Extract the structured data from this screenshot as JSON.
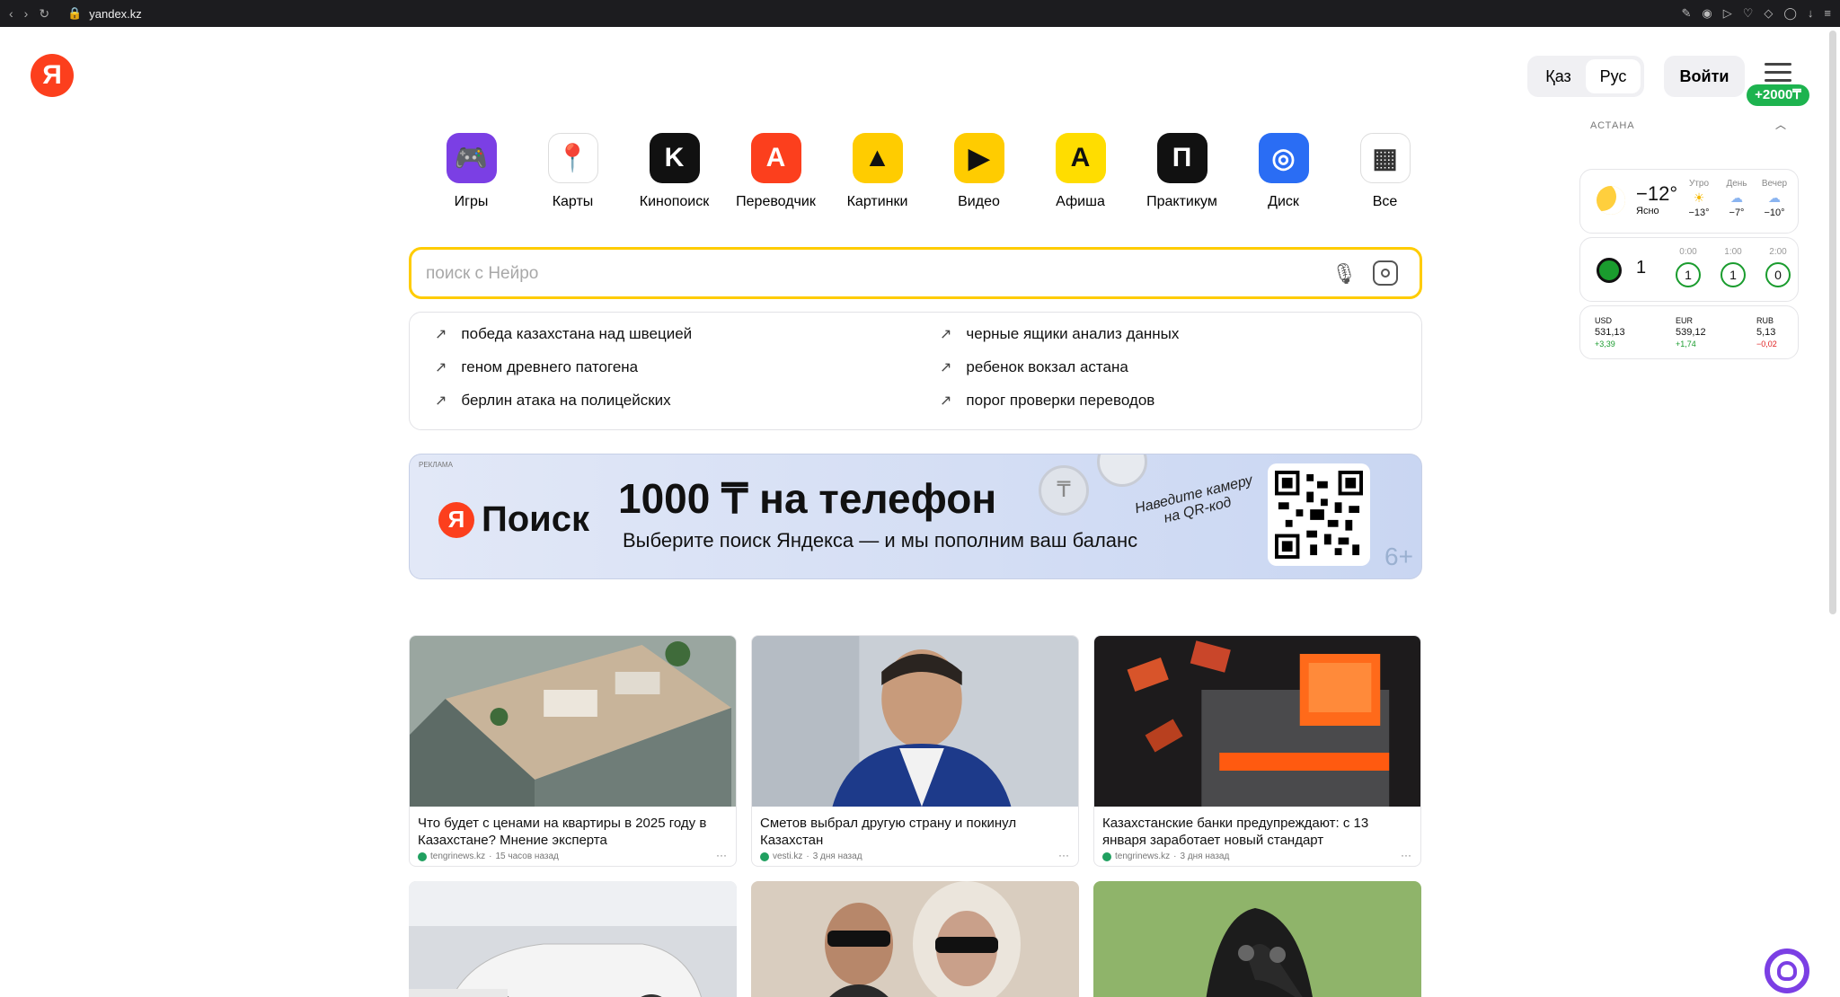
{
  "browser": {
    "url": "yandex.kz"
  },
  "header": {
    "lang_kaz": "Қаз",
    "lang_rus": "Рус",
    "login": "Войти",
    "bonus": "+2000₸"
  },
  "logo": "Я",
  "services": [
    {
      "label": "Игры",
      "color": "#7b3fe4",
      "glyph": "🎮"
    },
    {
      "label": "Карты",
      "color": "#ffffff",
      "glyph": "📍"
    },
    {
      "label": "Кинопоиск",
      "color": "#111111",
      "glyph": "K"
    },
    {
      "label": "Переводчик",
      "color": "#fc3f1d",
      "glyph": "A"
    },
    {
      "label": "Картинки",
      "color": "#ffcc00",
      "glyph": "▲"
    },
    {
      "label": "Видео",
      "color": "#ffcc00",
      "glyph": "▶"
    },
    {
      "label": "Афиша",
      "color": "#ffdd00",
      "glyph": "A"
    },
    {
      "label": "Практикум",
      "color": "#111111",
      "glyph": "П"
    },
    {
      "label": "Диск",
      "color": "#2a6df4",
      "glyph": "◎"
    },
    {
      "label": "Все",
      "color": "#ffffff",
      "glyph": "▦"
    }
  ],
  "search": {
    "placeholder": "поиск с Нейро"
  },
  "suggest": [
    "победа казахстана над швецией",
    "черные ящики анализ данных",
    "геном древнего патогена",
    "ребенок вокзал астана",
    "берлин атака на полицейских",
    "порог проверки переводов"
  ],
  "ad": {
    "tag": "РЕКЛАМА",
    "brand": "Поиск",
    "brand_ya": "Я",
    "headline": "1000 ₸ на телефон",
    "sub": "Выберите поиск Яндекса — и мы пополним ваш баланс",
    "hint": "Наведите камеру на QR-код",
    "coin": "₸",
    "age": "6+"
  },
  "news": [
    {
      "title": "Что будет с ценами на квартиры в 2025 году в Казахстане? Мнение эксперта",
      "source": "tengrinews.kz",
      "time": "15 часов назад"
    },
    {
      "title": "Сметов выбрал другую страну и покинул Казахстан",
      "source": "vesti.kz",
      "time": "3 дня назад"
    },
    {
      "title": "Казахстанские банки предупреждают: с 13 января заработает новый стандарт",
      "source": "tengrinews.kz",
      "time": "3 дня назад"
    }
  ],
  "weather": {
    "city": "АСТАНА",
    "temp": "−12°",
    "state": "Ясно",
    "parts": [
      {
        "name": "Утро",
        "t": "−13°"
      },
      {
        "name": "День",
        "t": "−7°"
      },
      {
        "name": "Вечер",
        "t": "−10°"
      }
    ]
  },
  "sport": {
    "value": "1",
    "slots": [
      {
        "time": "0:00",
        "v": "1"
      },
      {
        "time": "1:00",
        "v": "1"
      },
      {
        "time": "2:00",
        "v": "0"
      }
    ]
  },
  "rates": [
    {
      "code": "USD",
      "value": "531,13",
      "delta": "+3,39",
      "dir": "up"
    },
    {
      "code": "EUR",
      "value": "539,12",
      "delta": "+1,74",
      "dir": "up"
    },
    {
      "code": "RUB",
      "value": "5,13",
      "delta": "−0,02",
      "dir": "down"
    }
  ]
}
